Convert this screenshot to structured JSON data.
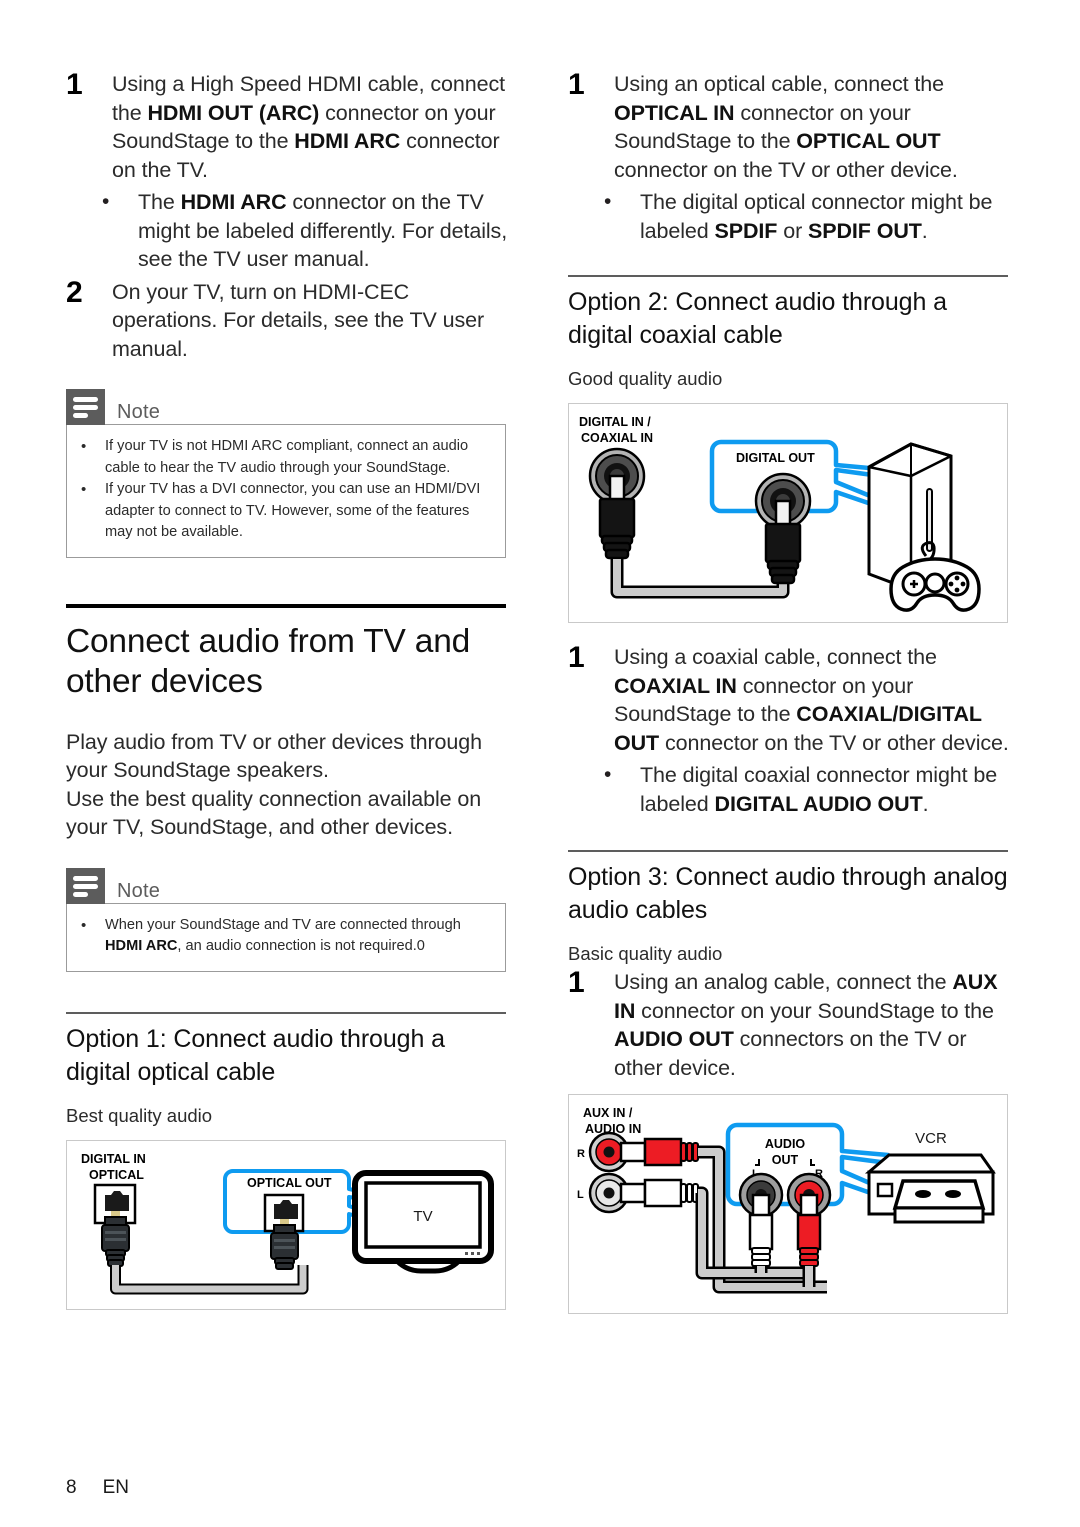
{
  "page": {
    "number": "8",
    "language": "EN"
  },
  "colors": {
    "callout_blue": "#0e9bf0",
    "rca_red": "#ed1c24",
    "note_gray": "#5c5c5c",
    "cable_gray": "#cccccc",
    "rule_black": "#000000"
  },
  "left_column": {
    "step1": {
      "number": "1",
      "text_parts": [
        {
          "t": "Using a High Speed HDMI cable, connect the ",
          "b": false
        },
        {
          "t": "HDMI OUT (ARC)",
          "b": true
        },
        {
          "t": " connector on your SoundStage to the ",
          "b": false
        },
        {
          "t": "HDMI ARC",
          "b": true
        },
        {
          "t": " connector on the TV.",
          "b": false
        }
      ],
      "bullet": {
        "marker": "•",
        "parts": [
          {
            "t": "The ",
            "b": false
          },
          {
            "t": "HDMI ARC",
            "b": true
          },
          {
            "t": " connector on the TV might be labeled differently. For details, see the TV user manual.",
            "b": false
          }
        ]
      }
    },
    "step2": {
      "number": "2",
      "text_parts": [
        {
          "t": "On your TV, turn on HDMI-CEC operations. For details, see the TV user manual.",
          "b": false
        }
      ]
    },
    "note1": {
      "title": "Note",
      "items": [
        [
          {
            "t": "If your TV is not HDMI ARC compliant, connect an audio cable to hear the TV audio through your SoundStage.",
            "b": false
          }
        ],
        [
          {
            "t": "If your TV has a DVI connector, you can use an HDMI/DVI adapter to connect to TV. However, some of the features may not be available.",
            "b": false
          }
        ]
      ]
    },
    "main_heading": "Connect audio from TV and other devices",
    "intro_paragraph_1": "Play audio from TV or other devices through your SoundStage speakers.",
    "intro_paragraph_2": "Use the best quality connection available on your TV, SoundStage, and other devices.",
    "note2": {
      "title": "Note",
      "items": [
        [
          {
            "t": "When your SoundStage and TV are connected through ",
            "b": false
          },
          {
            "t": "HDMI ARC",
            "b": true
          },
          {
            "t": ", an audio connection is not required.0",
            "b": false
          }
        ]
      ]
    },
    "option1": {
      "heading": "Option 1: Connect audio through a digital optical cable",
      "quality": "Best quality audio"
    },
    "figure_optical": {
      "name": "optical-connection-diagram",
      "source_label_line1": "DIGITAL IN",
      "source_label_line2": "OPTICAL",
      "callout_label": "OPTICAL OUT",
      "device_label": "TV"
    }
  },
  "right_column": {
    "step1": {
      "number": "1",
      "text_parts": [
        {
          "t": "Using an optical cable, connect the ",
          "b": false
        },
        {
          "t": "OPTICAL IN",
          "b": true
        },
        {
          "t": " connector on your SoundStage to the ",
          "b": false
        },
        {
          "t": "OPTICAL OUT",
          "b": true
        },
        {
          "t": " connector on the TV or other device.",
          "b": false
        }
      ],
      "bullet": {
        "marker": "•",
        "parts": [
          {
            "t": "The digital optical connector might be labeled ",
            "b": false
          },
          {
            "t": "SPDIF",
            "b": true
          },
          {
            "t": " or ",
            "b": false
          },
          {
            "t": "SPDIF OUT",
            "b": true
          },
          {
            "t": ".",
            "b": false
          }
        ]
      }
    },
    "option2": {
      "heading": "Option 2: Connect audio through a digital coaxial cable",
      "quality": "Good quality audio"
    },
    "figure_coaxial": {
      "name": "coaxial-connection-diagram",
      "source_label_line1": "DIGITAL IN /",
      "source_label_line2": "COAXIAL IN",
      "callout_label": "DIGITAL OUT"
    },
    "step_coax": {
      "number": "1",
      "text_parts": [
        {
          "t": "Using a coaxial cable, connect the ",
          "b": false
        },
        {
          "t": "COAXIAL IN",
          "b": true
        },
        {
          "t": " connector on your SoundStage to the ",
          "b": false
        },
        {
          "t": "COAXIAL/DIGITAL OUT",
          "b": true
        },
        {
          "t": " connector on the TV or other device.",
          "b": false
        }
      ],
      "bullet": {
        "marker": "•",
        "parts": [
          {
            "t": "The digital coaxial connector might be labeled ",
            "b": false
          },
          {
            "t": "DIGITAL AUDIO OUT",
            "b": true
          },
          {
            "t": ".",
            "b": false
          }
        ]
      }
    },
    "option3": {
      "heading": "Option 3: Connect audio through analog audio cables",
      "quality": "Basic quality audio"
    },
    "step_analog": {
      "number": "1",
      "text_parts": [
        {
          "t": "Using an analog cable, connect the ",
          "b": false
        },
        {
          "t": "AUX IN",
          "b": true
        },
        {
          "t": " connector on your SoundStage to the ",
          "b": false
        },
        {
          "t": "AUDIO OUT",
          "b": true
        },
        {
          "t": " connectors on the TV or other device.",
          "b": false
        }
      ]
    },
    "figure_analog": {
      "name": "analog-connection-diagram",
      "source_label_line1": "AUX IN /",
      "source_label_line2": "AUDIO IN",
      "channel_r": "R",
      "channel_l": "L",
      "callout_label_line1": "AUDIO",
      "callout_label_line2": "OUT",
      "callout_channel_l": "L",
      "callout_channel_r": "R",
      "device_label": "VCR"
    }
  }
}
